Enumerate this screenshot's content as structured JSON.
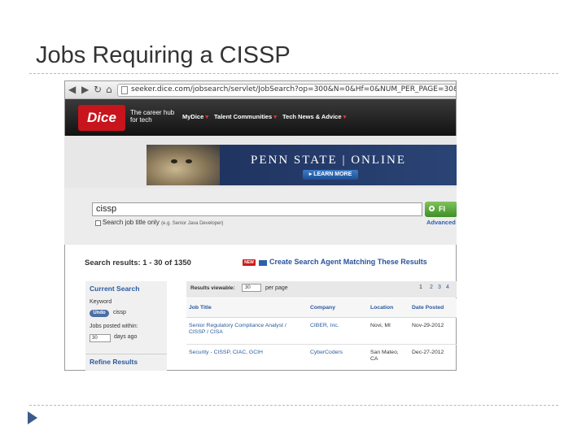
{
  "slide": {
    "title": "Jobs Requiring a CISSP"
  },
  "browser": {
    "nav": {
      "back": "◀",
      "forward": "▶",
      "reload": "↻",
      "home": "⌂"
    },
    "url": "seeker.dice.com/jobsearch/servlet/JobSearch?op=300&N=0&Hf=0&NUM_PER_PAGE=30&Ntk=JobSearchRanking&Nt"
  },
  "dice": {
    "logo": "Dice",
    "tagline": "The career hub for tech",
    "nav": [
      {
        "label": "MyDice"
      },
      {
        "label": "Talent Communities"
      },
      {
        "label": "Tech News & Advice"
      }
    ],
    "dropdown_marker": "▾"
  },
  "banner": {
    "title": "PENN STATE | ONLINE",
    "button": "▸ LEARN MORE"
  },
  "search": {
    "value": "cissp",
    "button": "FI",
    "checkbox_label": "Search job title only",
    "checkbox_hint": "(e.g. Senior Java Developer)",
    "advanced": "Advanced"
  },
  "results": {
    "count_text": "Search results: 1 - 30 of 1350",
    "new_badge": "NEW",
    "create_agent": "Create Search Agent Matching These Results",
    "viewable_label": "Results viewable:",
    "viewable_value": "30",
    "per_page": "per page",
    "pages": [
      "1",
      "2",
      "3",
      "4"
    ]
  },
  "left_panel": {
    "current_search": "Current Search",
    "keyword_label": "Keyword",
    "undo": "Undo",
    "keyword_value": "cissp",
    "posted_label": "Jobs posted within:",
    "days_value": "30",
    "days_label": "days ago",
    "refine": "Refine Results"
  },
  "table": {
    "headers": [
      "Job Title",
      "Company",
      "Location",
      "Date Posted"
    ],
    "rows": [
      {
        "title": "Senior Regulatory Compliance Analyst / CISSP / CISA",
        "company": "CIBER, Inc.",
        "location": "Novi, MI",
        "date": "Nov-29-2012"
      },
      {
        "title": "Security - CISSP, CIAC, GCIH",
        "company": "CyberCoders",
        "location": "San Mateo, CA",
        "date": "Dec-27-2012"
      }
    ]
  }
}
